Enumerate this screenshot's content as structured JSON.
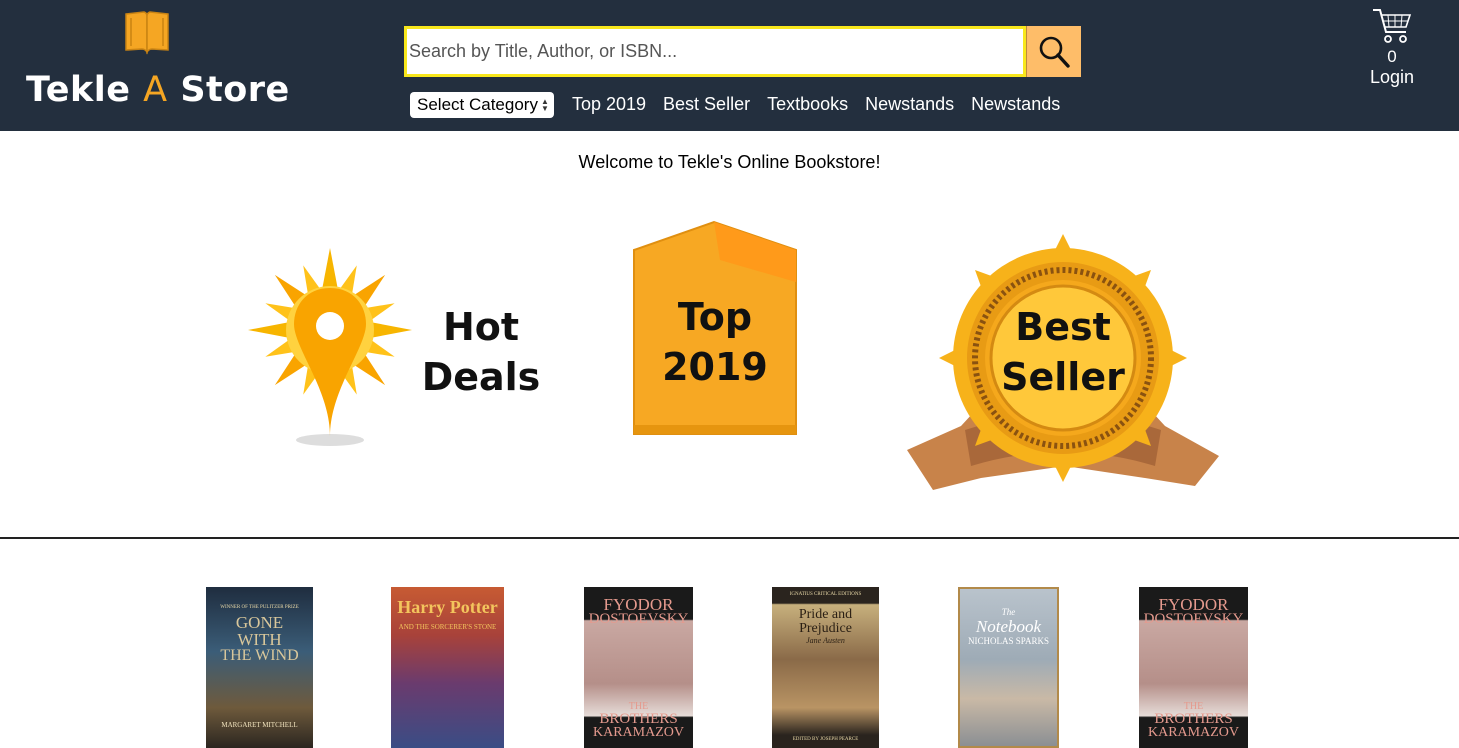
{
  "header": {
    "logo_text_left": "Tekle",
    "logo_text_accent": "A",
    "logo_text_right": "Store",
    "logo_icon": "open-book-icon",
    "search": {
      "placeholder": "Search by Title, Author, or ISBN...",
      "value": "",
      "button_icon": "search-icon"
    },
    "category_select": "Select Category",
    "nav_links": [
      "Top 2019",
      "Best Seller",
      "Textbooks",
      "Newstands",
      "Newstands"
    ],
    "cart": {
      "icon": "shopping-cart-icon",
      "count": "0"
    },
    "login": "Login"
  },
  "welcome_text": "Welcome to Tekle's Online Bookstore!",
  "promos": [
    {
      "id": "hot-deals",
      "line1": "Hot",
      "line2": "Deals",
      "icon": "sun-location-pin-icon"
    },
    {
      "id": "top-2019",
      "line1": "Top",
      "line2": "2019",
      "icon": "orange-tag-icon"
    },
    {
      "id": "best-seller",
      "line1": "Best",
      "line2": "Seller",
      "icon": "award-badge-icon"
    }
  ],
  "books": [
    {
      "id": "gone-with-the-wind",
      "title_lines": [
        "GONE",
        "WITH",
        "THE WIND"
      ],
      "top_text": "WINNER OF THE PULITZER PRIZE",
      "author": "MARGARET MITCHELL",
      "bg": "#2c3a4a"
    },
    {
      "id": "harry-potter",
      "title_lines": [
        "Harry Potter"
      ],
      "subtitle": "AND THE SORCERER'S STONE",
      "bg": "#b84a2e"
    },
    {
      "id": "brothers-karamazov-1",
      "title_lines": [
        "FYODOR",
        "DOSTOEVSKY"
      ],
      "bottom_lines": [
        "THE",
        "BROTHERS",
        "KARAMAZOV"
      ],
      "bg": "#1a1a1a"
    },
    {
      "id": "pride-and-prejudice",
      "title_lines": [
        "Pride and",
        "Prejudice"
      ],
      "author": "Jane Austen",
      "top_text": "IGNATIUS CRITICAL EDITIONS",
      "bottom_text": "EDITED BY JOSEPH PEARCE",
      "bg": "#2a241e"
    },
    {
      "id": "the-notebook",
      "title_lines": [
        "The",
        "Notebook"
      ],
      "author": "NICHOLAS SPARKS",
      "bg": "#9aa7b3"
    },
    {
      "id": "brothers-karamazov-2",
      "title_lines": [
        "FYODOR",
        "DOSTOEVSKY"
      ],
      "bottom_lines": [
        "THE",
        "BROTHERS",
        "KARAMAZOV"
      ],
      "bg": "#1a1a1a"
    }
  ],
  "colors": {
    "header_bg": "#232f3e",
    "accent": "#f5a623",
    "search_button": "#febd69",
    "search_border": "#f8e71c"
  }
}
